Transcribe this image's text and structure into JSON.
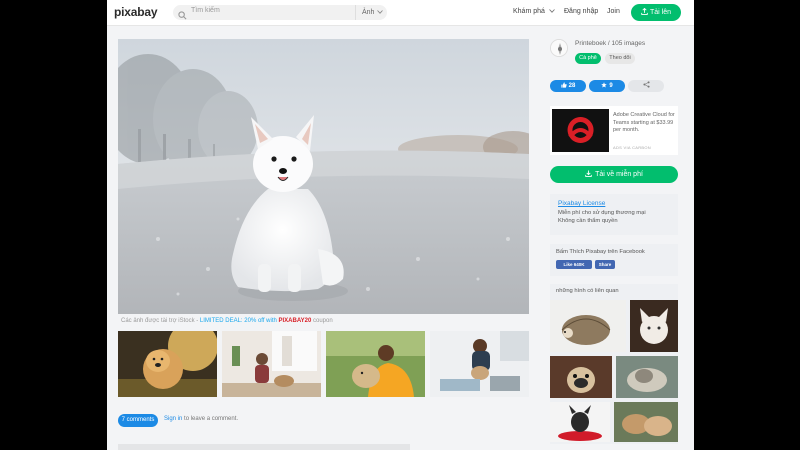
{
  "header": {
    "logo": "pixabay",
    "search_placeholder": "Tìm kiếm",
    "search_type": "Ảnh",
    "nav_explore": "Khám phá",
    "nav_login": "Đăng nhập",
    "nav_join": "Join",
    "upload_label": "Tải lên"
  },
  "main": {
    "sponsor_prefix": "Các ảnh được tài trợ iStock - ",
    "sponsor_deal": "LIMITED DEAL: 20% off with ",
    "sponsor_code": "PIXABAY20",
    "sponsor_suffix": " coupon",
    "comments_count": "7 comments",
    "signin_link": "Sign in",
    "signin_text": " to leave a comment."
  },
  "sidebar": {
    "author": "Printeboek / 105 images",
    "donate": "Cà phê",
    "follow": "Theo dõi",
    "likes": "28",
    "favorites": "9",
    "ad_text": "Adobe Creative Cloud for Teams starting at $33.99 per month.",
    "ad_via": "ADS VIA CARBON",
    "download": "Tải về miễn phí",
    "license_title": "Pixabay License",
    "license_line1": "Miễn phí cho sử dụng thương mại",
    "license_line2": "Không cần thẩm quyền",
    "fb_text": "Bấm Thích Pixabay trên Facebook",
    "fb_like": "Like 640K",
    "fb_share": "Share",
    "related_title": "những hình có liên quan"
  },
  "colors": {
    "brand_green": "#02be6e",
    "link_blue": "#1c8ae5",
    "facebook_blue": "#4267b2"
  }
}
